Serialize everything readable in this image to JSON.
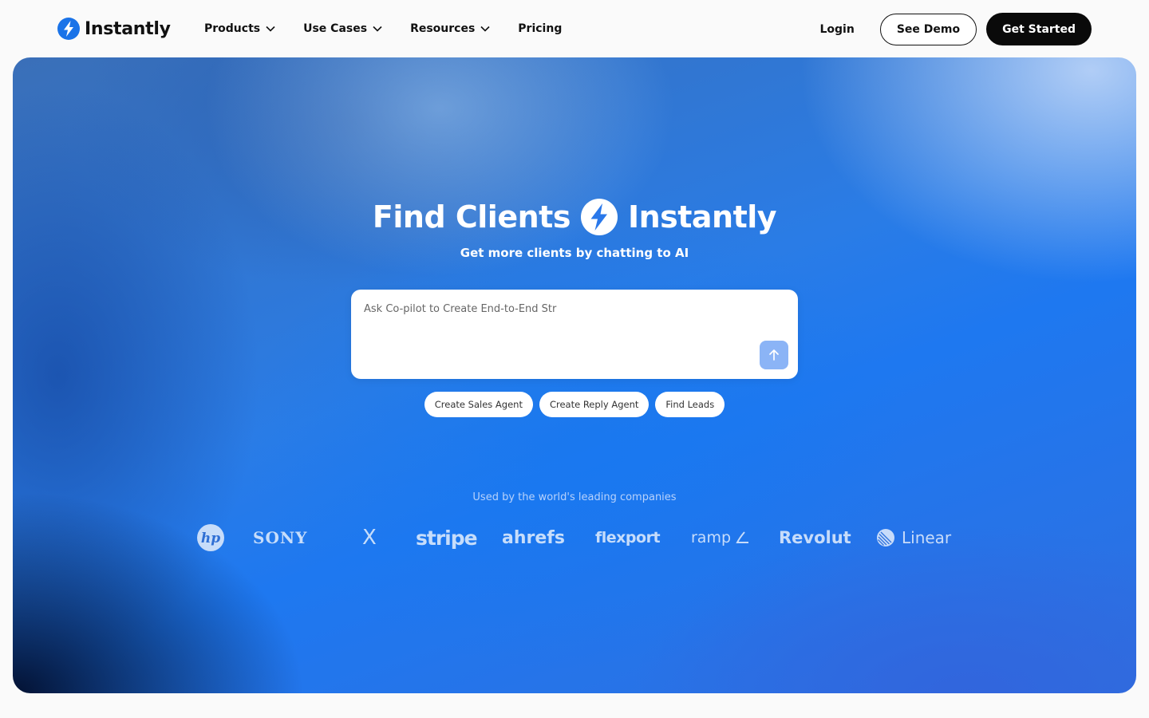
{
  "nav": {
    "brand": "Instantly",
    "menu": [
      {
        "label": "Products",
        "has_dropdown": true
      },
      {
        "label": "Use Cases",
        "has_dropdown": true
      },
      {
        "label": "Resources",
        "has_dropdown": true
      },
      {
        "label": "Pricing",
        "has_dropdown": false
      }
    ],
    "login": "Login",
    "demo_button": "See Demo",
    "start_button": "Get Started"
  },
  "hero": {
    "title_left": "Find Clients",
    "title_right": "Instantly",
    "subtitle": "Get more clients by chatting to AI",
    "prompt": {
      "value": "",
      "placeholder": "Ask Co-pilot to Create End-to-End Str"
    },
    "chips": [
      "Create Sales Agent",
      "Create Reply Agent",
      "Find Leads"
    ],
    "used_by": "Used by the world's leading companies",
    "logos": [
      "hp",
      "SONY",
      "X",
      "stripe",
      "ahrefs",
      "flexport",
      "ramp",
      "Revolut",
      "Linear"
    ]
  },
  "icons": {
    "logo": "lightning-bolt-icon",
    "dropdown": "chevron-down-icon",
    "send": "arrow-up-icon"
  },
  "colors": {
    "brand_blue": "#1a73e8",
    "button_dark": "#0a0a0a",
    "send_button": "#8bb4f6"
  }
}
